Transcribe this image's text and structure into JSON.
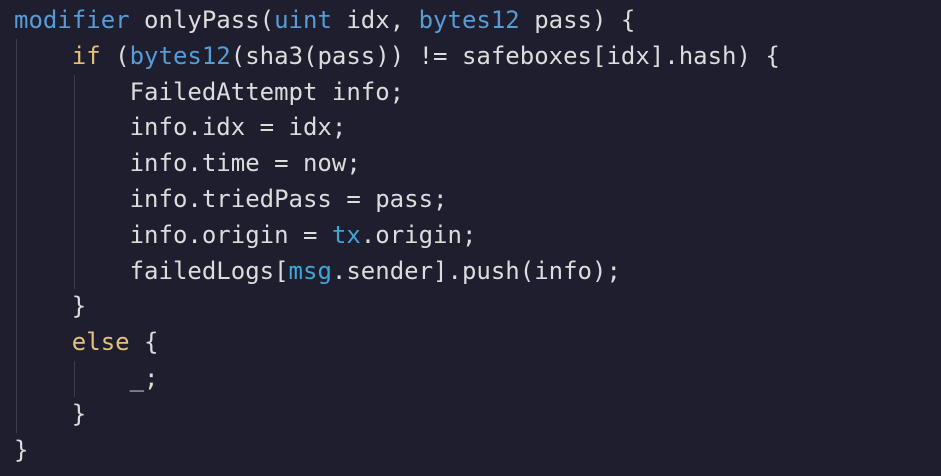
{
  "theme": {
    "background": "#1e1e2e",
    "default_text": "#dcdcdc",
    "keyword": "#569cd6",
    "control_keyword": "#e5c07b",
    "builtin": "#3ea6d8",
    "indent_guide": "#3a3d4c"
  },
  "code_lines": [
    {
      "indent": 0,
      "tokens": [
        {
          "text": "modifier",
          "kind": "keyword"
        },
        {
          "text": " onlyPass(",
          "kind": "plain"
        },
        {
          "text": "uint",
          "kind": "keyword"
        },
        {
          "text": " idx, ",
          "kind": "plain"
        },
        {
          "text": "bytes12",
          "kind": "keyword"
        },
        {
          "text": " pass) {",
          "kind": "plain"
        }
      ]
    },
    {
      "indent": 4,
      "tokens": [
        {
          "text": "if",
          "kind": "control"
        },
        {
          "text": " (",
          "kind": "plain"
        },
        {
          "text": "bytes12",
          "kind": "keyword"
        },
        {
          "text": "(sha3(pass)) != safeboxes[idx].hash) {",
          "kind": "plain"
        }
      ]
    },
    {
      "indent": 8,
      "tokens": [
        {
          "text": "FailedAttempt info;",
          "kind": "plain"
        }
      ]
    },
    {
      "indent": 8,
      "tokens": [
        {
          "text": "info.idx = idx;",
          "kind": "plain"
        }
      ]
    },
    {
      "indent": 8,
      "tokens": [
        {
          "text": "info.time = now;",
          "kind": "plain"
        }
      ]
    },
    {
      "indent": 8,
      "tokens": [
        {
          "text": "info.triedPass = pass;",
          "kind": "plain"
        }
      ]
    },
    {
      "indent": 8,
      "tokens": [
        {
          "text": "info.origin = ",
          "kind": "plain"
        },
        {
          "text": "tx",
          "kind": "builtin"
        },
        {
          "text": ".origin;",
          "kind": "plain"
        }
      ]
    },
    {
      "indent": 8,
      "tokens": [
        {
          "text": "failedLogs[",
          "kind": "plain"
        },
        {
          "text": "msg",
          "kind": "builtin"
        },
        {
          "text": ".sender].push(info);",
          "kind": "plain"
        }
      ]
    },
    {
      "indent": 4,
      "tokens": [
        {
          "text": "}",
          "kind": "plain"
        }
      ]
    },
    {
      "indent": 4,
      "tokens": [
        {
          "text": "else",
          "kind": "control"
        },
        {
          "text": " {",
          "kind": "plain"
        }
      ]
    },
    {
      "indent": 8,
      "tokens": [
        {
          "text": "_;",
          "kind": "plain"
        }
      ]
    },
    {
      "indent": 4,
      "tokens": [
        {
          "text": "}",
          "kind": "plain"
        }
      ]
    },
    {
      "indent": 0,
      "tokens": [
        {
          "text": "}",
          "kind": "plain"
        }
      ]
    }
  ]
}
